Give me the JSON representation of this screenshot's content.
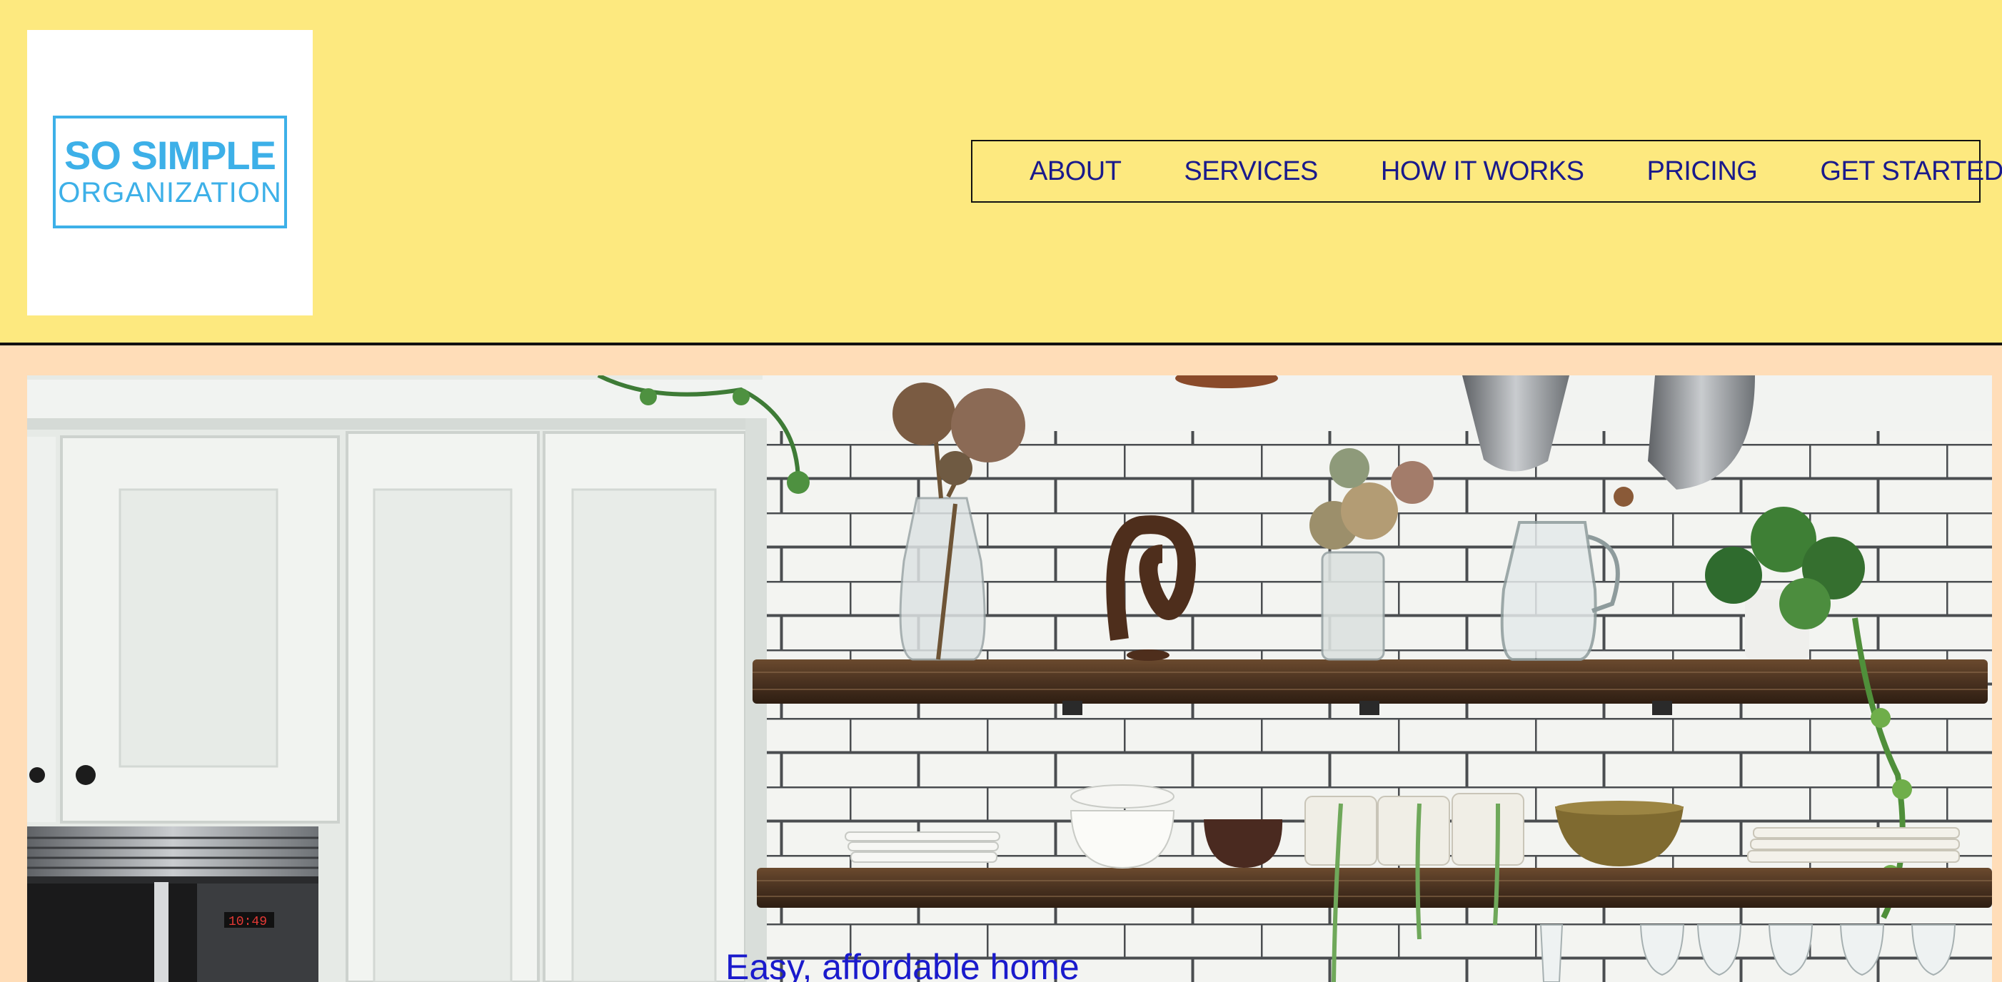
{
  "header": {
    "logo": {
      "line1": "SO SIMPLE",
      "line2": "ORGANIZATION"
    },
    "nav": {
      "items": [
        {
          "label": "ABOUT"
        },
        {
          "label": "SERVICES"
        },
        {
          "label": "HOW IT WORKS"
        },
        {
          "label": "PRICING"
        },
        {
          "label": "GET STARTED"
        }
      ]
    }
  },
  "hero": {
    "image_subject": "kitchen-open-shelving-photo",
    "headline": "Easy, affordable home"
  },
  "colors": {
    "header_bg": "#FDE97F",
    "page_bg": "#FFDDB8",
    "logo_blue": "#3DB0E8",
    "nav_text": "#1A1A8C",
    "headline_text": "#1A1ACC"
  }
}
